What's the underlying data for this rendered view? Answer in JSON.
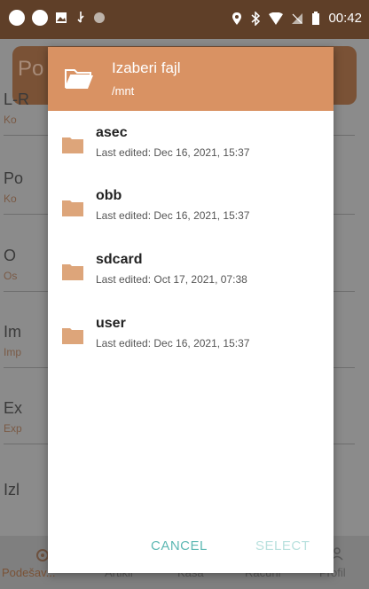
{
  "status_bar": {
    "time": "00:42"
  },
  "background_app": {
    "header_title": "Po",
    "items": [
      {
        "title": "L-R",
        "subtitle": "Ko"
      },
      {
        "title": "Po",
        "subtitle": "Ko"
      },
      {
        "title": "O",
        "subtitle": "Os"
      },
      {
        "title": "Im",
        "subtitle": "Imp"
      },
      {
        "title": "Ex",
        "subtitle": "Exp"
      },
      {
        "title": "Izl",
        "subtitle": ""
      }
    ],
    "bottom_nav": [
      "Podešav...",
      "Artikli",
      "Kasa",
      "Računi",
      "Profil"
    ]
  },
  "dialog": {
    "title": "Izaberi fajl",
    "path": "/mnt",
    "files": [
      {
        "name": "asec",
        "date": "Last edited: Dec 16, 2021, 15:37"
      },
      {
        "name": "obb",
        "date": "Last edited: Dec 16, 2021, 15:37"
      },
      {
        "name": "sdcard",
        "date": "Last edited: Oct 17, 2021, 07:38"
      },
      {
        "name": "user",
        "date": "Last edited: Dec 16, 2021, 15:37"
      }
    ],
    "cancel_label": "CANCEL",
    "select_label": "SELECT"
  },
  "colors": {
    "accent": "#d99263",
    "folder": "#dda57a",
    "button_active": "#5db8b3",
    "button_disabled": "#b9e1de"
  }
}
